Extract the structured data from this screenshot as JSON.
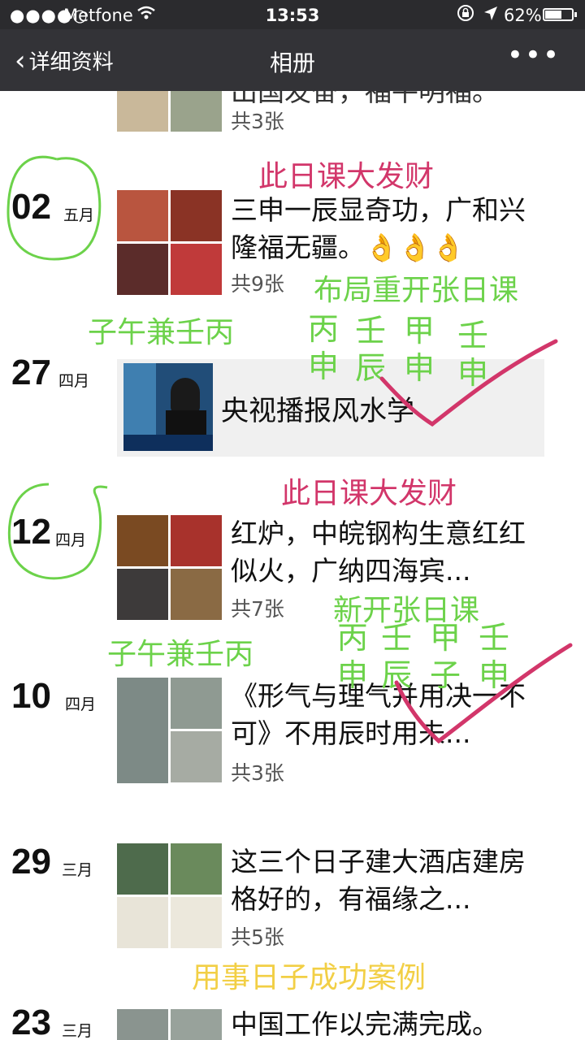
{
  "status_bar": {
    "signal": "●●●●○",
    "carrier": "Metfone",
    "wifi_icon": "wifi-icon",
    "time": "13:53",
    "battery_percent": "62%",
    "battery_level": 0.62
  },
  "nav": {
    "back_label": "详细资料",
    "title": "相册",
    "more_icon": "more-icon"
  },
  "entries": [
    {
      "day": "",
      "month": "",
      "caption": "出国发奋，福平明福。",
      "count": "共3张"
    },
    {
      "day": "02",
      "month": "五月",
      "caption": "三申一辰显奇功，广和兴隆福无疆。👌👌👌",
      "count": "共9张"
    },
    {
      "day": "27",
      "month": "四月",
      "caption": "央视播报风水学"
    },
    {
      "day": "12",
      "month": "四月",
      "caption": "红炉，中皖钢构生意红红似火，广纳四海宾...",
      "count": "共7张"
    },
    {
      "day": "10",
      "month": "四月",
      "caption": "《形气与理气并用决一不可》不用辰时用未...",
      "count": "共3张"
    },
    {
      "day": "29",
      "month": "三月",
      "caption": "这三个日子建大酒店建房格好的，有福缘之...",
      "count": "共5张"
    },
    {
      "day": "23",
      "month": "三月",
      "caption": "中国工作以完满完成。"
    }
  ],
  "annotations": {
    "note1": "此日课大发财",
    "note2": "布局重开张日课",
    "note3": "子午兼壬丙",
    "cols1": [
      [
        "丙",
        "申"
      ],
      [
        "壬",
        "辰"
      ],
      [
        "甲",
        "申"
      ],
      [
        "壬",
        "申"
      ]
    ],
    "note4": "此日课大发财",
    "note5": "新开张日课",
    "note6": "子午兼壬丙",
    "cols2": [
      [
        "丙",
        "申"
      ],
      [
        "壬",
        "辰"
      ],
      [
        "甲",
        "子"
      ],
      [
        "壬",
        "申"
      ]
    ],
    "note7": "用事日子成功案例"
  },
  "colors": {
    "statusbar": "#2b2b2e",
    "navbar": "#333337",
    "pink": "#d2366a",
    "green": "#6cd24a",
    "yellow": "#f2cf45"
  }
}
